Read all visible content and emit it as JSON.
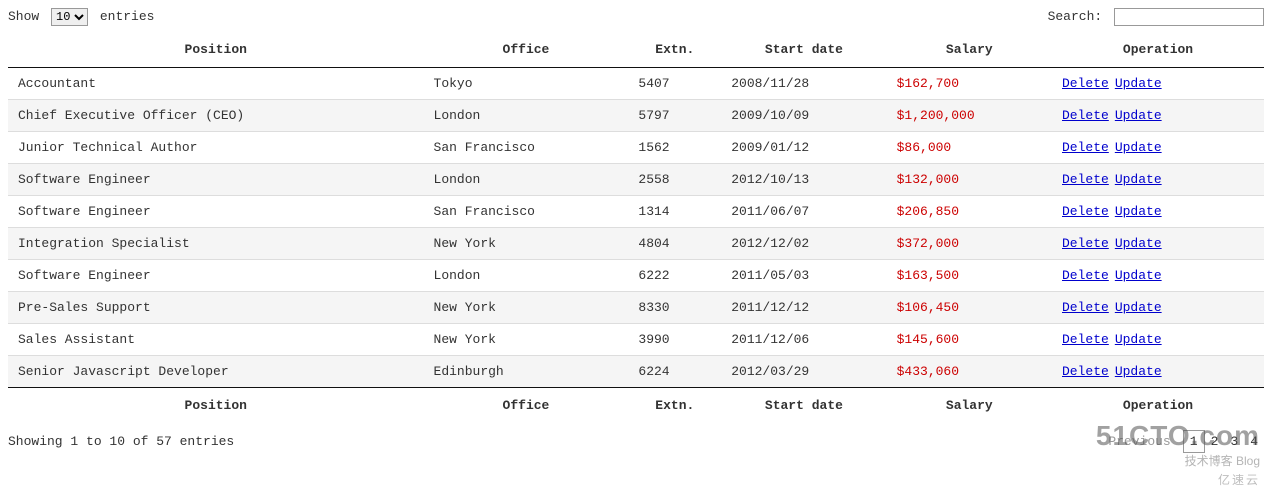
{
  "controls": {
    "show_label_before": "Show",
    "show_label_after": "entries",
    "page_size": "10",
    "search_label": "Search:",
    "search_value": ""
  },
  "columns": [
    "Position",
    "Office",
    "Extn.",
    "Start date",
    "Salary",
    "Operation"
  ],
  "footer_columns": [
    "Position",
    "Office",
    "Extn.",
    "Start date",
    "Salary",
    "Operation"
  ],
  "operation": {
    "delete_label": "Delete",
    "update_label": "Update"
  },
  "rows": [
    {
      "position": "Accountant",
      "office": "Tokyo",
      "extn": "5407",
      "start_date": "2008/11/28",
      "salary": "$162,700"
    },
    {
      "position": "Chief Executive Officer (CEO)",
      "office": "London",
      "extn": "5797",
      "start_date": "2009/10/09",
      "salary": "$1,200,000"
    },
    {
      "position": "Junior Technical Author",
      "office": "San Francisco",
      "extn": "1562",
      "start_date": "2009/01/12",
      "salary": "$86,000"
    },
    {
      "position": "Software Engineer",
      "office": "London",
      "extn": "2558",
      "start_date": "2012/10/13",
      "salary": "$132,000"
    },
    {
      "position": "Software Engineer",
      "office": "San Francisco",
      "extn": "1314",
      "start_date": "2011/06/07",
      "salary": "$206,850"
    },
    {
      "position": "Integration Specialist",
      "office": "New York",
      "extn": "4804",
      "start_date": "2012/12/02",
      "salary": "$372,000"
    },
    {
      "position": "Software Engineer",
      "office": "London",
      "extn": "6222",
      "start_date": "2011/05/03",
      "salary": "$163,500"
    },
    {
      "position": "Pre-Sales Support",
      "office": "New York",
      "extn": "8330",
      "start_date": "2011/12/12",
      "salary": "$106,450"
    },
    {
      "position": "Sales Assistant",
      "office": "New York",
      "extn": "3990",
      "start_date": "2011/12/06",
      "salary": "$145,600"
    },
    {
      "position": "Senior Javascript Developer",
      "office": "Edinburgh",
      "extn": "6224",
      "start_date": "2012/03/29",
      "salary": "$433,060"
    }
  ],
  "info_text": "Showing 1 to 10 of 57 entries",
  "pagination": {
    "previous": "Previous",
    "pages": [
      "1",
      "2",
      "3",
      "4"
    ],
    "current": "1"
  },
  "watermark": {
    "main": "51CTO.com",
    "sub": "技术博客  Blog",
    "stamp": "亿速云"
  }
}
